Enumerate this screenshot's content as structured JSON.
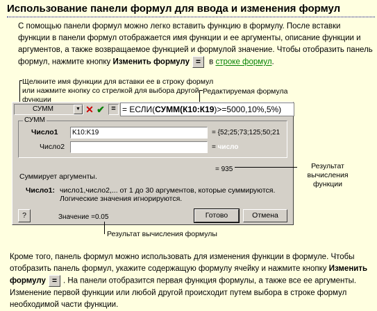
{
  "title": "Использование панели формул для ввода и изменения формул",
  "intro": {
    "text": "С помощью панели формул можно легко вставить функцию в формулу. После вставки функции в панели формул отображается имя функции и ее аргументы, описание функции и аргументов, а также возвращаемое функцией и формулой значение. Чтобы отобразить панель формул, нажмите кнопку ",
    "bold": "Изменить формулу",
    "button_glyph": "=",
    "in_text": " в ",
    "link": "строке формул",
    "end": "."
  },
  "annotations": {
    "click_name": "Щелкните имя функции для вставки ее в строку формул или нажмите кнопку со стрелкой для выбора другой функции",
    "edited_formula": "Редактируемая формула",
    "func_result": "Результат вычисления функции",
    "formula_result": "Результат вычисления формулы"
  },
  "dialog": {
    "name_box": "СУММ",
    "dropdown_glyph": "▼",
    "cancel_glyph": "✕",
    "enter_glyph": "✔",
    "edit_glyph": "=",
    "formula_prefix": "= ЕСЛИ(",
    "formula_bold": "СУММ(К10:К19",
    "formula_suffix": ")>=5000,10%,5%)",
    "group_label": "СУММ",
    "arg1_label": "Число1",
    "arg1_value": "K10:K19",
    "arg1_result": "= {52;25;73;125;50;21",
    "arg2_label": "Число2",
    "arg2_value": "",
    "arg2_result_eq": "=",
    "arg2_result": "число",
    "func_value": "= 935",
    "description": "Суммирует аргументы.",
    "arg_desc_label": "Число1:",
    "arg_desc_text": "число1,число2,... от 1 до 30 аргументов, которые суммируются. Логические значения игнорируются.",
    "help_glyph": "?",
    "formula_value_label": "Значение =",
    "formula_value": "0.05",
    "ok": "Готово",
    "cancel": "Отмена"
  },
  "outro": {
    "text1": "Кроме того, панель формул можно использовать для изменения функции в формуле. Чтобы отобразить панель формул, укажите содержащую формулу ячейку и нажмите кнопку ",
    "bold": "Изменить формулу",
    "button_glyph": "=",
    "text2": ". На панели отобразится первая функция формулы, а также все ее аргументы. Изменение первой функции или любой другой происходит путем выбора в строке формул необходимой части функции."
  }
}
